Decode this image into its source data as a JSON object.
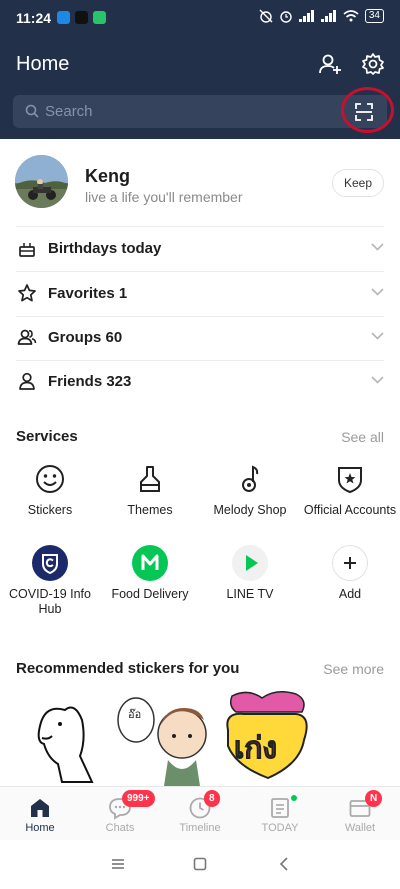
{
  "status_bar": {
    "time": "11:24",
    "battery": "34"
  },
  "header": {
    "title": "Home",
    "search_placeholder": "Search"
  },
  "profile": {
    "name": "Keng",
    "status_message": "live a life you'll remember",
    "keep_label": "Keep"
  },
  "friend_list": [
    {
      "label": "Birthdays today",
      "icon": "cake-icon"
    },
    {
      "label": "Favorites 1",
      "icon": "star-icon"
    },
    {
      "label": "Groups 60",
      "icon": "groups-icon"
    },
    {
      "label": "Friends 323",
      "icon": "person-icon"
    }
  ],
  "services": {
    "title": "Services",
    "see_all": "See all",
    "items": [
      {
        "label": "Stickers",
        "icon": "smiley-icon"
      },
      {
        "label": "Themes",
        "icon": "brush-icon"
      },
      {
        "label": "Melody Shop",
        "icon": "music-note-icon"
      },
      {
        "label": "Official Accounts",
        "icon": "shield-star-icon"
      },
      {
        "label": "COVID-19 Info Hub",
        "icon": "covid-shield-icon"
      },
      {
        "label": "Food Delivery",
        "icon": "line-man-icon"
      },
      {
        "label": "LINE TV",
        "icon": "play-icon"
      },
      {
        "label": "Add",
        "icon": "plus-icon"
      }
    ]
  },
  "stickers": {
    "title": "Recommended stickers for you",
    "see_more": "See more"
  },
  "bottom_nav": [
    {
      "label": "Home",
      "icon": "home-icon",
      "badge": ""
    },
    {
      "label": "Chats",
      "icon": "chat-bubble-icon",
      "badge": "999+"
    },
    {
      "label": "Timeline",
      "icon": "clock-icon",
      "badge": "8"
    },
    {
      "label": "TODAY",
      "icon": "news-icon",
      "badge": ""
    },
    {
      "label": "Wallet",
      "icon": "wallet-icon",
      "badge": "N"
    }
  ],
  "colors": {
    "header_bg": "#22304a",
    "search_bg": "#35435d",
    "badge_red": "#ff334b",
    "line_green": "#06c755",
    "highlight_circle": "#c8102e"
  }
}
